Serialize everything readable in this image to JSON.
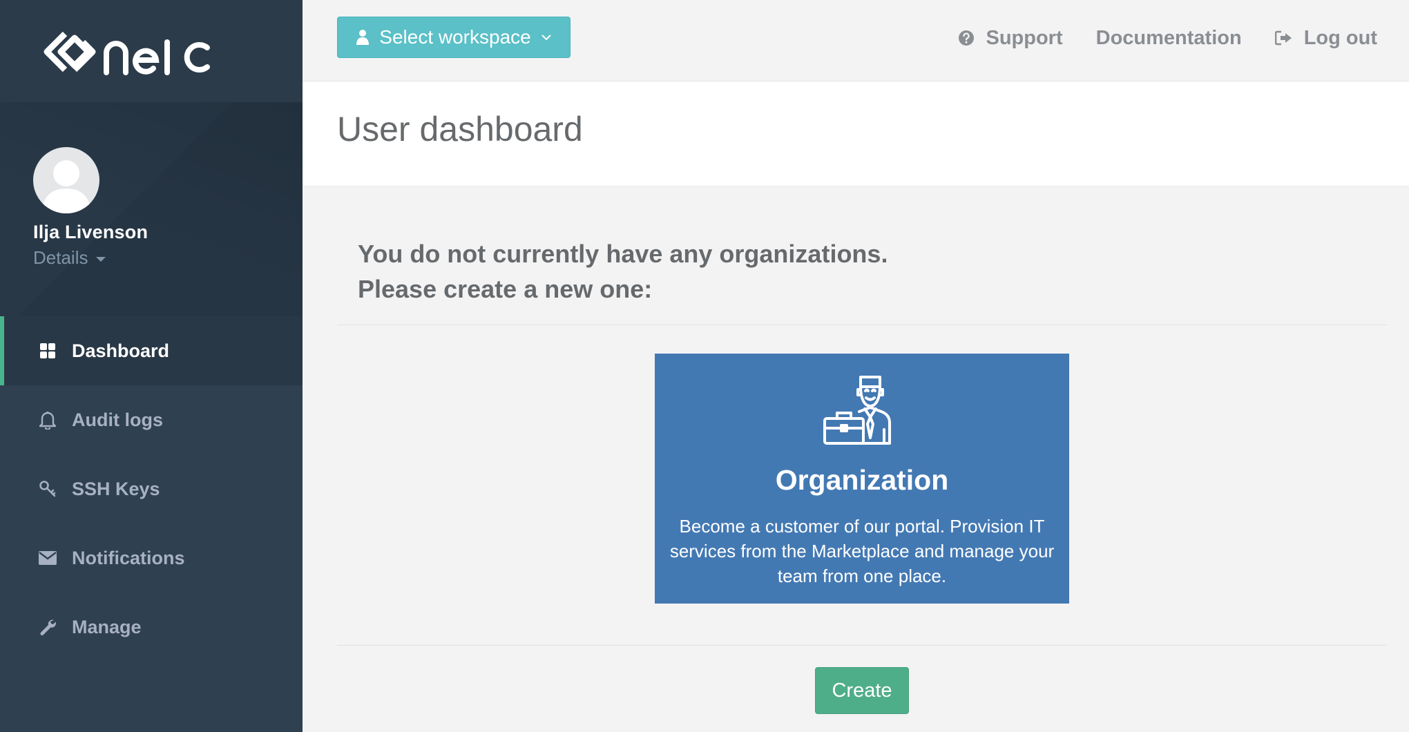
{
  "brand": {
    "logo_text": "neic"
  },
  "profile": {
    "name": "Ilja Livenson",
    "details_label": "Details"
  },
  "sidebar": {
    "items": [
      {
        "label": "Dashboard",
        "icon": "dashboard-icon",
        "active": true
      },
      {
        "label": "Audit logs",
        "icon": "bell-icon",
        "active": false
      },
      {
        "label": "SSH Keys",
        "icon": "key-icon",
        "active": false
      },
      {
        "label": "Notifications",
        "icon": "envelope-icon",
        "active": false
      },
      {
        "label": "Manage",
        "icon": "wrench-icon",
        "active": false
      }
    ]
  },
  "topbar": {
    "workspace_label": "Select workspace",
    "links": {
      "support": "Support",
      "documentation": "Documentation",
      "logout": "Log out"
    }
  },
  "page": {
    "title": "User dashboard"
  },
  "main": {
    "message_line1": "You do not currently have any organizations.",
    "message_line2": "Please create a new one:",
    "card": {
      "title": "Organization",
      "description": "Become a customer of our portal. Provision IT services from the Marketplace and manage your team from one place."
    },
    "create_label": "Create"
  },
  "colors": {
    "sidebar_bg": "#2f4050",
    "active_accent": "#48b58c",
    "workspace_button": "#5bc0c7",
    "card_bg": "#4379b3",
    "create_button": "#4fae8a"
  }
}
